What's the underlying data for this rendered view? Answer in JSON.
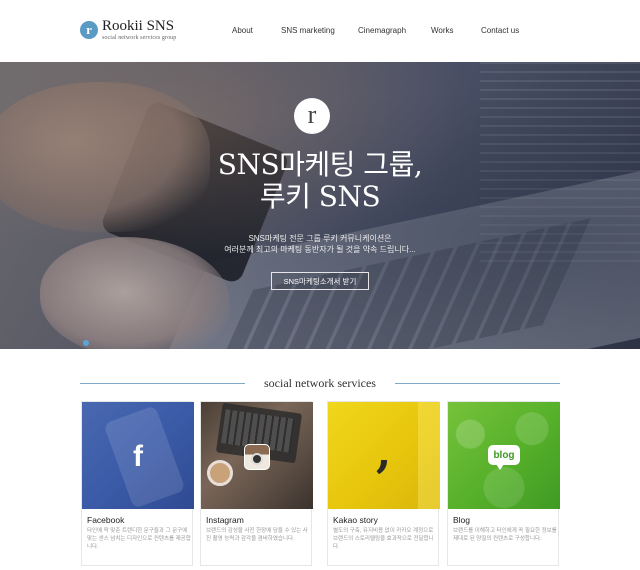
{
  "header": {
    "logo_mark": "r",
    "logo_title": "Rookii SNS",
    "logo_sub": "social network services group",
    "nav": [
      "About",
      "SNS marketing",
      "Cinemagraph",
      "Works",
      "Contact us"
    ]
  },
  "hero": {
    "logo_mark": "r",
    "title_line1": "SNS마케팅 그룹,",
    "title_line2": "루키 SNS",
    "sub_line1": "SNS마케팅 전문 그룹 루키 커뮤니케이션은",
    "sub_line2": "여러분께 최고의 마케팅 동반자가 될 것을 약속 드립니다...",
    "button": "SNS마케팅소개서 받기"
  },
  "section": {
    "title": "social network services",
    "cards": [
      {
        "title": "Facebook",
        "icon": "facebook-icon",
        "desc": "타인에 딱 맞춘 트렌디한 문구들과 그 문구에 맞는 센스 넘치는 디자인으로 컨텐츠를 제공합니다."
      },
      {
        "title": "Instagram",
        "icon": "instagram-icon",
        "desc": "브랜드의 감성을 사진 한장에 담을 수 있는 사진 촬영 능력과 감각을 겸비하였습니다."
      },
      {
        "title": "Kakao story",
        "icon": "kakaostory-icon",
        "desc": "별도의 구축, 유지비용 없이 카카오 계정으로 브랜드의 스토리텔링을 효과적으로 전달합니다."
      },
      {
        "title": "Blog",
        "icon": "blog-icon",
        "icon_label": "blog",
        "desc": "브랜드를 이해하고 타인에게 꼭 필요한 정보를 제대로 된 양질의 컨텐츠로 구성합니다."
      }
    ]
  },
  "colors": {
    "accent": "#5aa6da",
    "rule": "#7fa9c8",
    "facebook": "#3b5ba8",
    "kakao": "#e6c40c",
    "blog": "#56b02a"
  }
}
